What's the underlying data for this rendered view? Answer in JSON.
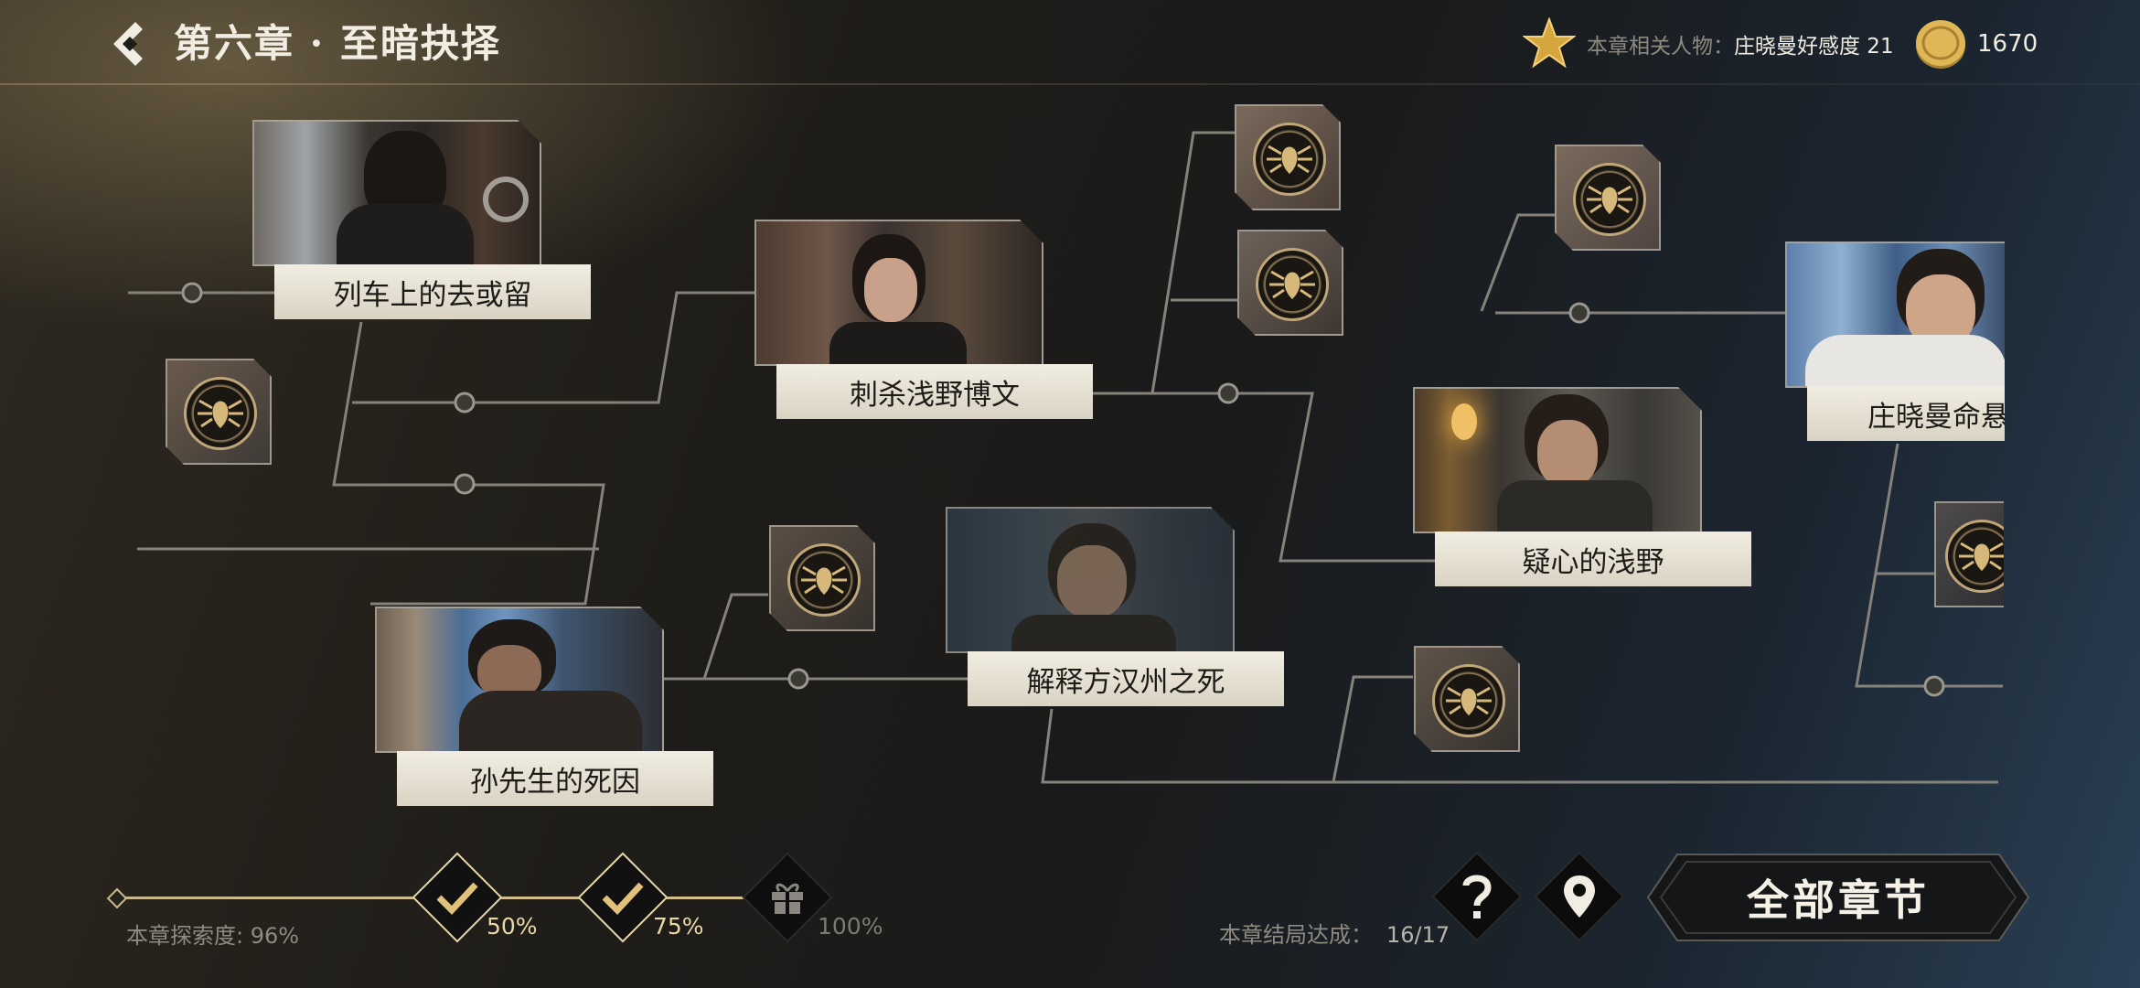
{
  "header": {
    "title": "第六章 · 至暗抉择",
    "related_label": "本章相关人物：",
    "related_value": "庄晓曼好感度 21",
    "coins": "1670"
  },
  "nodes": {
    "train": "列车上的去或留",
    "assassinate": "刺杀浅野博文",
    "suspicious": "疑心的浅野",
    "zhuang": "庄晓曼命悬",
    "explain": "解释方汉州之死",
    "sun": "孙先生的死因"
  },
  "footer": {
    "explore_label": "本章探索度:",
    "explore_value": "96%",
    "milestones": [
      "50%",
      "75%",
      "100%"
    ],
    "ending_label": "本章结局达成：",
    "ending_value": "16/17",
    "all_chapters": "全部章节"
  },
  "colors": {
    "accent_gold": "#d9b873",
    "label_bg": "#ebe6d9",
    "line": "#8a8780"
  },
  "icons": [
    "back-icon",
    "star-icon",
    "coin-icon",
    "check-icon",
    "gift-icon",
    "help-icon",
    "location-icon",
    "spider-emblem-icon"
  ]
}
